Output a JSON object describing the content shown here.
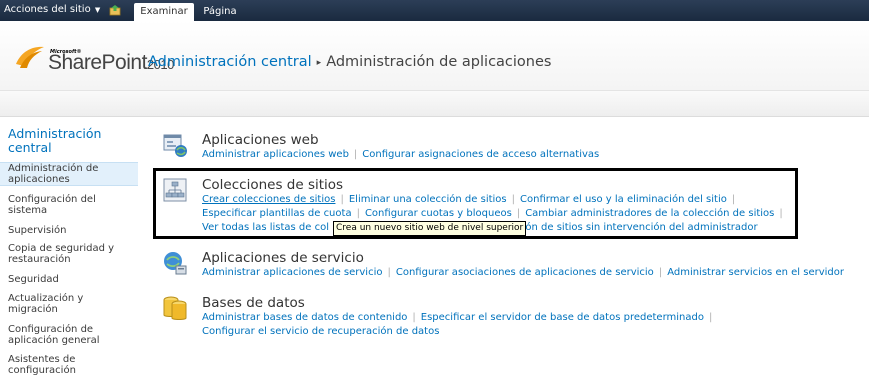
{
  "ribbon": {
    "site_actions": "Acciones del sitio",
    "tabs": [
      {
        "label": "Examinar",
        "active": true
      },
      {
        "label": "Página",
        "active": false
      }
    ]
  },
  "header": {
    "logo_microsoft": "Microsoft®",
    "logo_product": "SharePoint",
    "logo_version": "2010",
    "breadcrumb": [
      "Administración central",
      "Administración de aplicaciones"
    ]
  },
  "quicklaunch": {
    "heading": "Administración central",
    "items": [
      {
        "label": "Administración de aplicaciones",
        "selected": true
      },
      {
        "label": "Configuración del sistema",
        "selected": false
      },
      {
        "label": "Supervisión",
        "selected": false
      },
      {
        "label": "Copia de seguridad y restauración",
        "selected": false
      },
      {
        "label": "Seguridad",
        "selected": false
      },
      {
        "label": "Actualización y migración",
        "selected": false
      },
      {
        "label": "Configuración de aplicación general",
        "selected": false
      },
      {
        "label": "Asistentes de configuración",
        "selected": false
      }
    ]
  },
  "groups": {
    "web_apps": {
      "title": "Aplicaciones web",
      "links": [
        "Administrar aplicaciones web",
        "Configurar asignaciones de acceso alternativas"
      ]
    },
    "site_collections": {
      "title": "Colecciones de sitios",
      "line1": [
        "Crear colecciones de sitios",
        "Eliminar una colección de sitios",
        "Confirmar el uso y la eliminación del sitio"
      ],
      "line2": [
        "Especificar plantillas de cuota",
        "Configurar cuotas y bloqueos",
        "Cambiar administradores de la colección de sitios"
      ],
      "line3_start": "Ver todas las listas de col",
      "line3_end": "ación de sitios sin intervención del administrador"
    },
    "service_apps": {
      "title": "Aplicaciones de servicio",
      "links": [
        "Administrar aplicaciones de servicio",
        "Configurar asociaciones de aplicaciones de servicio",
        "Administrar servicios en el servidor"
      ]
    },
    "databases": {
      "title": "Bases de datos",
      "line1": [
        "Administrar bases de datos de contenido",
        "Especificar el servidor de base de datos predeterminado"
      ],
      "line2": [
        "Configurar el servicio de recuperación de datos"
      ]
    }
  },
  "tooltip": "Crea un nuevo sitio web de nivel superior",
  "colors": {
    "ribbon": "#1f2f45",
    "link": "#0072bc",
    "selected_nav": "#e2f0fb",
    "highlight_border": "#000000"
  }
}
